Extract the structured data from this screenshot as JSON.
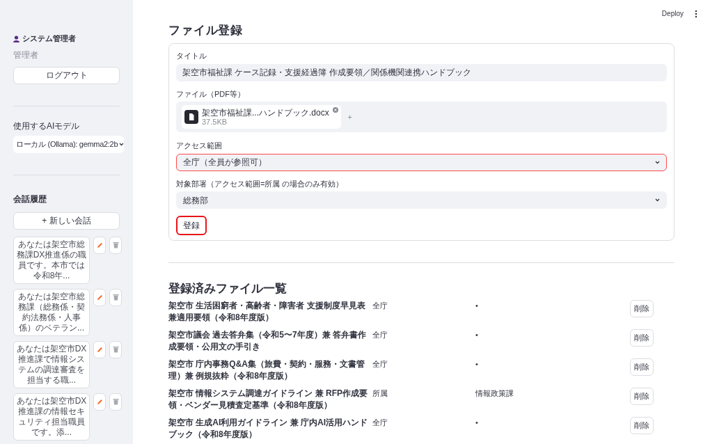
{
  "sidebar": {
    "user_name": "システム管理者",
    "role": "管理者",
    "logout_button": "ログアウト",
    "model_label": "使用するAIモデル",
    "model_select": "ローカル (Ollama): gemma2:2b",
    "history_title": "会話履歴",
    "new_chat_button": "+ 新しい会話",
    "history": [
      {
        "text": "あなたは架空市総務課DX推進係の職員です。本市では令和8年..."
      },
      {
        "text": "あなたは架空市総務課（総務係・契約法務係・人事係）のベテラン..."
      },
      {
        "text": "あなたは架空市DX推進課で情報システムの調達審査を担当する職..."
      },
      {
        "text": "あなたは架空市DX推進課の情報セキュリティ担当職員です。添..."
      }
    ]
  },
  "header": {
    "deploy": "Deploy"
  },
  "form": {
    "heading": "ファイル登録",
    "title_label": "タイトル",
    "title_value": "架空市福祉課 ケース記録・支援経過簿 作成要領／関係機関連携ハンドブック",
    "file_label": "ファイル（PDF等）",
    "file_name": "架空市福祉課...ハンドブック.docx",
    "file_size": "37.5KB",
    "add_more": "+",
    "access_label": "アクセス範囲",
    "access_value": "全庁（全員が参照可）",
    "access_focused": true,
    "dept_label": "対象部署（アクセス範囲=所属 の場合のみ有効）",
    "dept_value": "総務部",
    "submit": {
      "label": "登録",
      "highlighted": true
    }
  },
  "files": {
    "heading": "登録済みファイル一覧",
    "rows": [
      {
        "title": "架空市 生活困窮者・高齢者・障害者 支援制度早見表兼適用要領（令和8年度版）",
        "scope": "全庁",
        "department": "•",
        "delete": "削除"
      },
      {
        "title": "架空市議会 過去答弁集（令和5〜7年度）兼 答弁書作成要領・公用文の手引き",
        "scope": "全庁",
        "department": "•",
        "delete": "削除"
      },
      {
        "title": "架空市 庁内事務Q&A集（旅費・契約・服務・文書管理）兼 例規抜粋（令和8年度版）",
        "scope": "全庁",
        "department": "•",
        "delete": "削除"
      },
      {
        "title": "架空市 情報システム調達ガイドライン 兼 RFP作成要領・ベンダー見積査定基準（令和8年度版）",
        "scope": "所属",
        "department": "情報政策課",
        "delete": "削除"
      },
      {
        "title": "架空市 生成AI利用ガイドライン 兼 庁内AI活用ハンドブック（令和8年度版）",
        "scope": "全庁",
        "department": "•",
        "delete": "削除"
      }
    ]
  }
}
